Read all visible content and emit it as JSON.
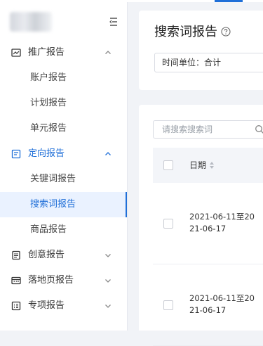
{
  "sidebar": {
    "items": [
      {
        "type": "group",
        "label": "推广报告",
        "icon": "chart-line-icon",
        "expanded": true
      },
      {
        "type": "sub",
        "label": "账户报告"
      },
      {
        "type": "sub",
        "label": "计划报告"
      },
      {
        "type": "sub",
        "label": "单元报告"
      },
      {
        "type": "group",
        "label": "定向报告",
        "icon": "target-list-icon",
        "expanded": true,
        "active": true
      },
      {
        "type": "sub",
        "label": "关键词报告"
      },
      {
        "type": "sub",
        "label": "搜索词报告",
        "active": true
      },
      {
        "type": "sub",
        "label": "商品报告"
      },
      {
        "type": "group",
        "label": "创意报告",
        "icon": "creative-icon",
        "expanded": false
      },
      {
        "type": "group",
        "label": "落地页报告",
        "icon": "landing-page-icon",
        "expanded": false
      },
      {
        "type": "group",
        "label": "专项报告",
        "icon": "special-report-icon",
        "expanded": false
      }
    ]
  },
  "header": {
    "title": "搜索词报告",
    "time_unit_label": "时间单位：合计"
  },
  "table": {
    "search_placeholder": "请搜索搜索词",
    "columns": [
      "日期"
    ],
    "rows": [
      {
        "date": "2021-06-11至2021-06-17"
      },
      {
        "date": "2021-06-11至2021-06-17"
      }
    ]
  },
  "colors": {
    "accent": "#1f6fd8",
    "active_bg": "#eaf2ff",
    "page_bg": "#f1f3f7"
  }
}
